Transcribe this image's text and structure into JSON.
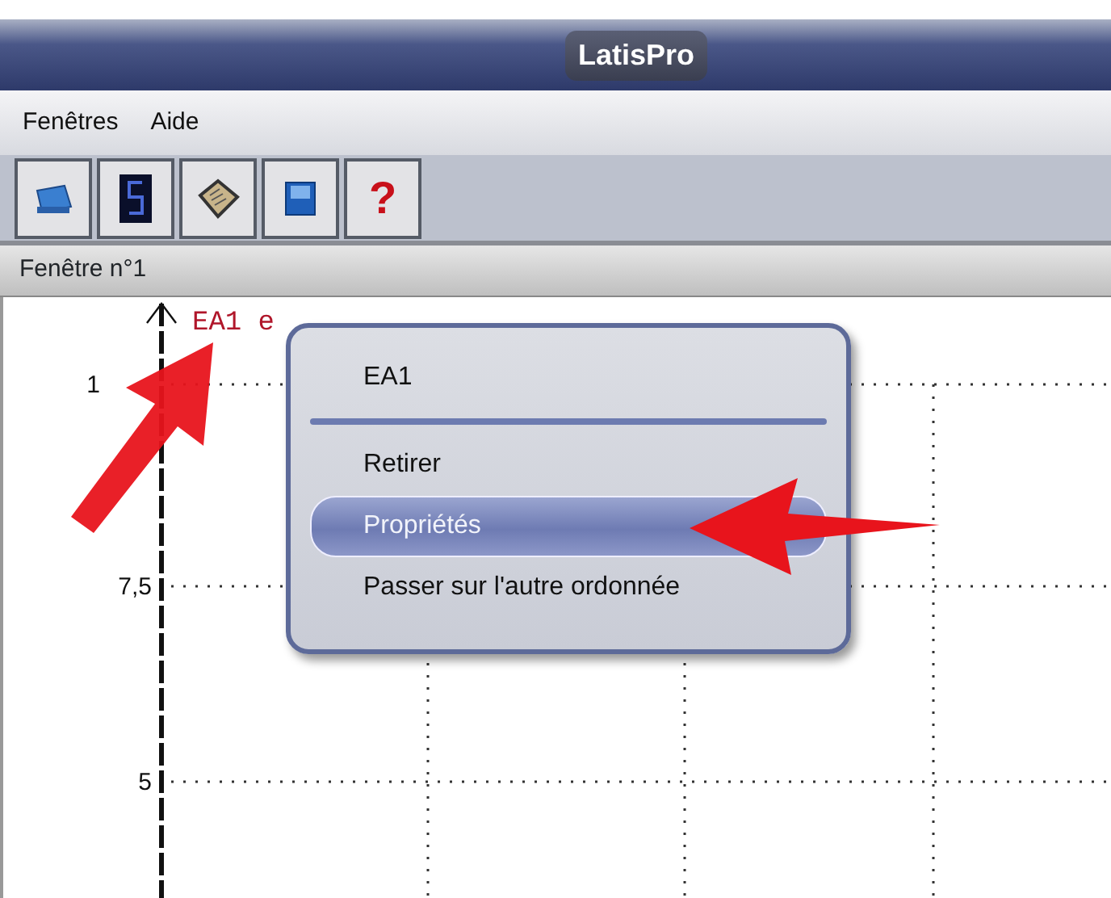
{
  "window": {
    "title": "LatisPro"
  },
  "menu_bar": [
    {
      "label": "Fenêtres"
    },
    {
      "label": "Aide"
    }
  ],
  "toolbar": [
    {
      "kind": "icon"
    },
    {
      "kind": "icon"
    },
    {
      "kind": "icon"
    },
    {
      "kind": "icon"
    },
    {
      "kind": "text",
      "label": "?"
    }
  ],
  "document": {
    "title": "Fenêtre n°1"
  },
  "plot": {
    "axis_label": "EA1 e",
    "y_labels": [
      "1",
      "7,5",
      "5"
    ]
  },
  "context_menu": {
    "header": "EA1",
    "items": [
      {
        "label": "Retirer",
        "selected": false
      },
      {
        "label": "Propriétés",
        "selected": true
      },
      {
        "label": "Passer sur l'autre ordonnée",
        "selected": false
      }
    ]
  }
}
